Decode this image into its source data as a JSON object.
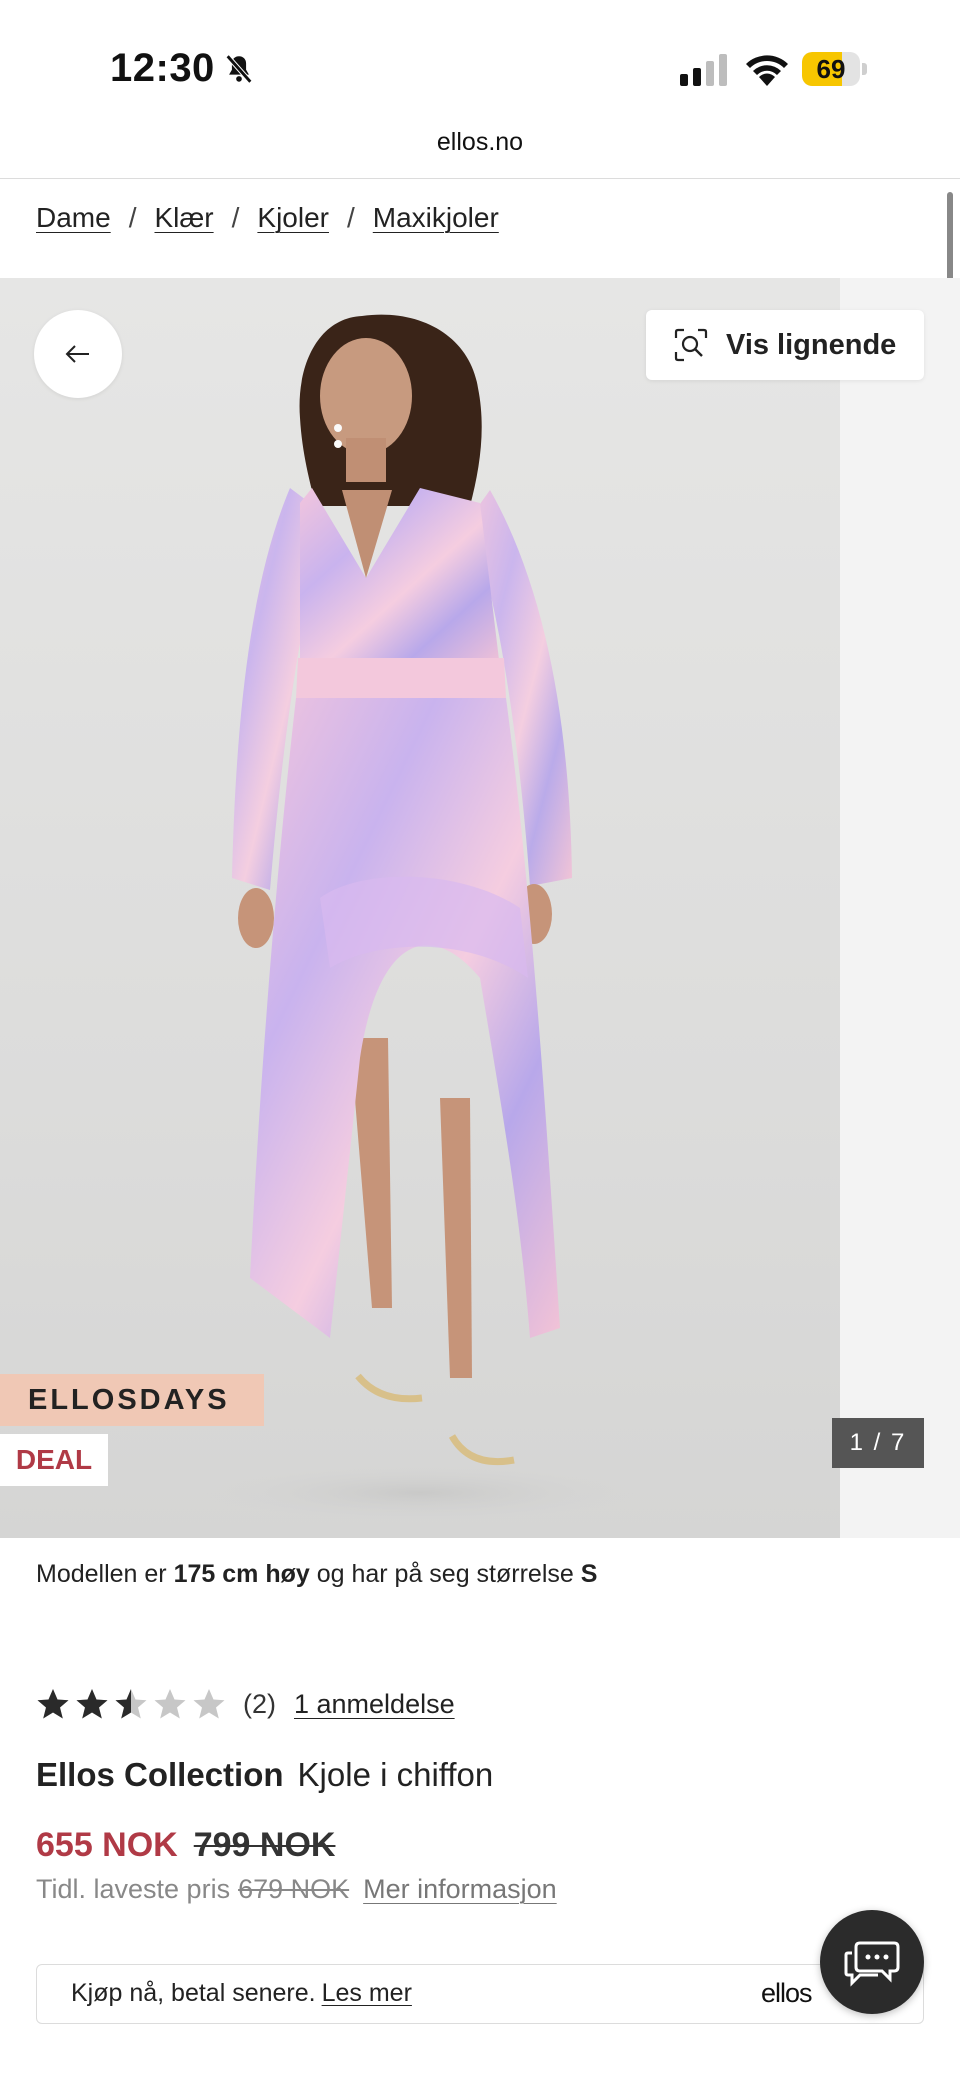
{
  "status_bar": {
    "time": "12:30",
    "battery_level": "69",
    "battery_fraction": 0.69,
    "icons": [
      "bell-slash-icon",
      "cellular-signal-icon",
      "wifi-icon",
      "battery-icon"
    ]
  },
  "browser": {
    "url": "ellos.no"
  },
  "breadcrumb": {
    "items": [
      "Dame",
      "Klær",
      "Kjoler",
      "Maxikjoler"
    ],
    "separator": "/"
  },
  "gallery": {
    "similar_label": "Vis lignende",
    "badge_campaign": "ELLOSDAYS",
    "badge_deal": "DEAL",
    "counter": "1 / 7",
    "icons": [
      "arrow-left-icon",
      "visual-search-icon"
    ]
  },
  "model_info": {
    "prefix": "Modellen er ",
    "height": "175 cm høy",
    "middle": " og har på seg størrelse ",
    "size": "S"
  },
  "rating": {
    "value": 2.5,
    "max": 5,
    "count_text": "(2)",
    "reviews_link": "1 anmeldelse"
  },
  "product": {
    "brand": "Ellos Collection",
    "name": "Kjole i chiffon"
  },
  "price": {
    "current": "655 NOK",
    "original": "799 NOK",
    "lowest_label": "Tidl. laveste pris",
    "lowest_value": "679 NOK",
    "more_info": "Mer informasjon"
  },
  "bnpl": {
    "text": "Kjøp nå, betal senere.",
    "link": "Les mer",
    "logo_text": "ellos"
  },
  "colors": {
    "accent_price": "#b03a46",
    "campaign_badge_bg": "#f0c8b5",
    "chat_button_bg": "#2b2b2b",
    "battery_fill": "#f7c600"
  }
}
